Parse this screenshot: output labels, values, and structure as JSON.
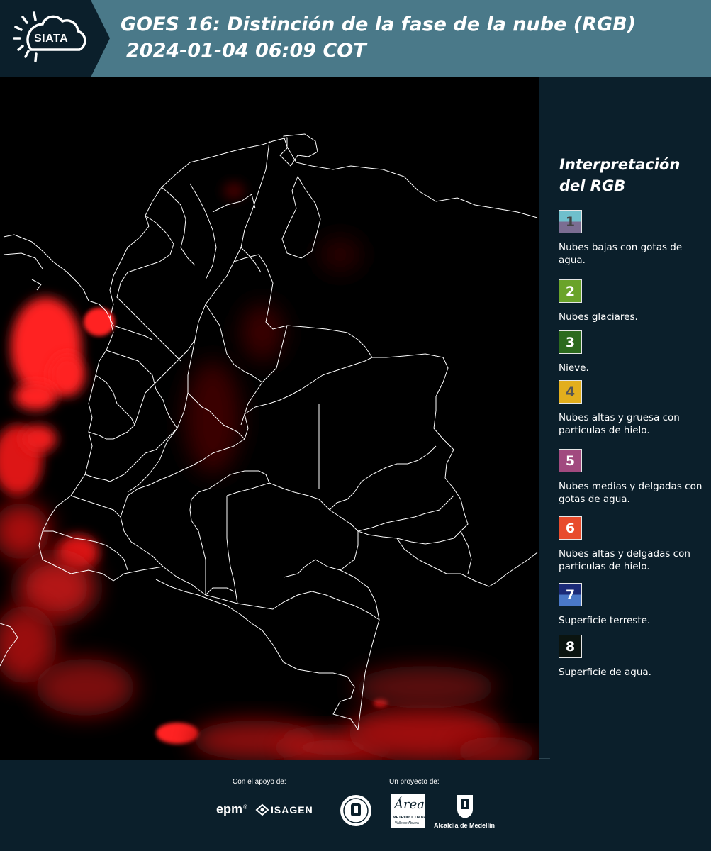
{
  "header": {
    "logo_text": "SIATA",
    "title_line1": "GOES 16: Distinción de la fase de la nube (RGB)",
    "title_line2": "2024-01-04 06:09 COT",
    "bg_color": "#4a7989",
    "logo_bg_color": "#0b1f2b"
  },
  "map": {
    "image_kind": "satellite RGB cloud phase composite with department boundaries",
    "background_color": "#000000",
    "cloud_color": "#ff1e1e"
  },
  "legend": {
    "title_line1": "Interpretación",
    "title_line2": "del RGB",
    "items": [
      {
        "number": "1",
        "label": "Nubes bajas con gotas de agua.",
        "color_top": "#6fbfcc",
        "color_bottom": "#7b6d92",
        "num_color": "#444444"
      },
      {
        "number": "2",
        "label": "Nubes glaciares.",
        "color_top": "#6aa32a",
        "color_bottom": "#6aa32a",
        "num_color": "#ffffff"
      },
      {
        "number": "3",
        "label": "Nieve.",
        "color_top": "#2c6a1e",
        "color_bottom": "#2c6a1e",
        "num_color": "#ffffff"
      },
      {
        "number": "4",
        "label": "Nubes altas y gruesa con particulas de hielo.",
        "color_top": "#e2ae1d",
        "color_bottom": "#e2ae1d",
        "num_color": "#555555"
      },
      {
        "number": "5",
        "label": "Nubes medias y delgadas con gotas de agua.",
        "color_top": "#a14a7f",
        "color_bottom": "#a14a7f",
        "num_color": "#ffffff"
      },
      {
        "number": "6",
        "label": "Nubes altas y delgadas con particulas de hielo.",
        "color_top": "#e84b2c",
        "color_bottom": "#e84b2c",
        "num_color": "#ffffff"
      },
      {
        "number": "7",
        "label": "Superficie terreste.",
        "color_top": "#1b2a78",
        "color_bottom": "#4a78c8",
        "num_color": "#ffffff"
      },
      {
        "number": "8",
        "label": "Superficie de agua.",
        "color_top": "#0b1410",
        "color_bottom": "#0b1410",
        "num_color": "#ffffff"
      }
    ]
  },
  "footer": {
    "support_label": "Con el apoyo de:",
    "project_label": "Un proyecto de:",
    "sponsor_1": "epm",
    "sponsor_2": "ISAGEN",
    "partner_area_1": "Área",
    "partner_area_2": "METROPOLITANA",
    "partner_area_3": "Valle de Aburrá",
    "partner_alcaldia": "Alcaldía de Medellín"
  }
}
